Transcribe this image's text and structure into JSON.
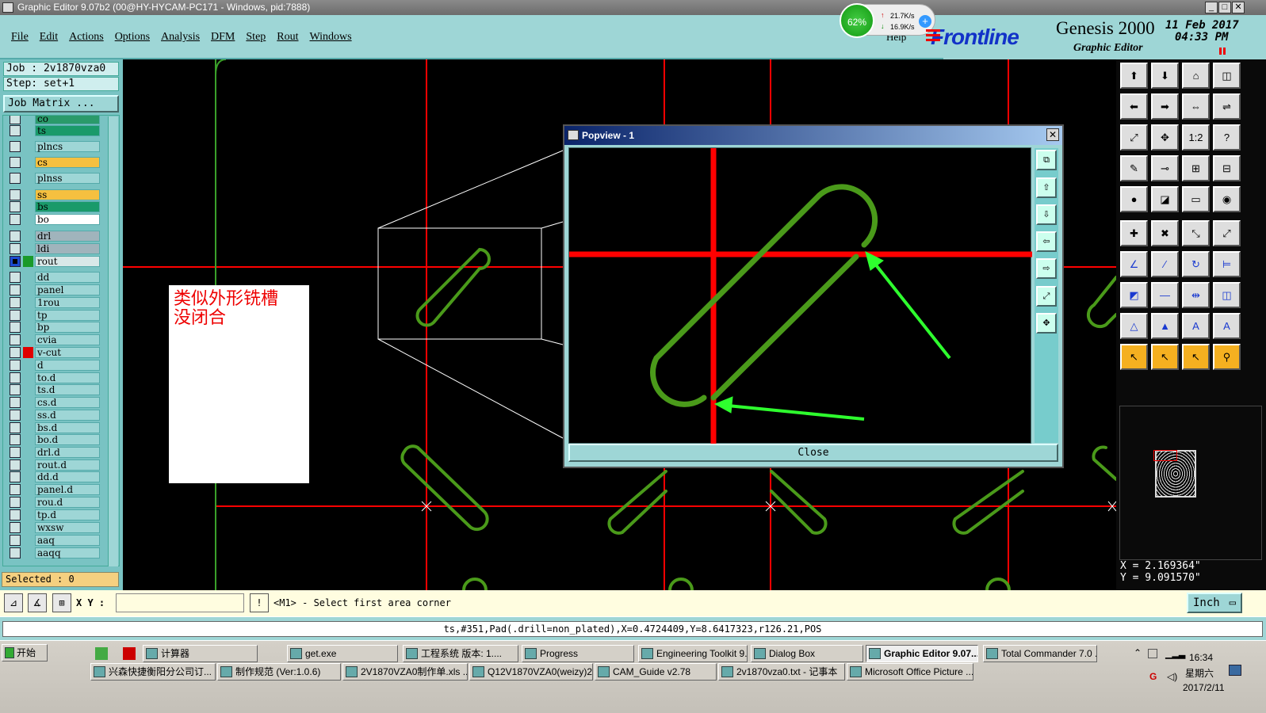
{
  "window": {
    "title": "Graphic Editor 9.07b2 (00@HY-HYCAM-PC171 - Windows, pid:7888)"
  },
  "menu": [
    "File",
    "Edit",
    "Actions",
    "Options",
    "Analysis",
    "DFM",
    "Step",
    "Rout",
    "Windows"
  ],
  "brand": {
    "logo": "Frontline",
    "product": "Genesis 2000",
    "subtitle": "Graphic Editor",
    "date": "11 Feb 2017",
    "time": "04:33 PM",
    "help": "Help"
  },
  "net": {
    "percent": "62%",
    "up": "21.7K/s",
    "down": "16.9K/s"
  },
  "left": {
    "job": "Job : 2v1870vza0",
    "step": "Step: set+1",
    "matrix": "Job Matrix ...",
    "selected": "Selected : 0",
    "layers": [
      {
        "name": "co",
        "color": "#2a9a6a",
        "checked": false
      },
      {
        "name": "ts",
        "color": "#1a9a6a",
        "checked": false
      },
      {
        "name": "plncs",
        "color": "#9ed6d6",
        "checked": false
      },
      {
        "name": "cs",
        "color": "#f5c040",
        "checked": false
      },
      {
        "name": "plnss",
        "color": "#9ed6d6",
        "checked": false
      },
      {
        "name": "ss",
        "color": "#f5c040",
        "checked": false
      },
      {
        "name": "bs",
        "color": "#1a9a6a",
        "checked": false
      },
      {
        "name": "bo",
        "color": "#ffffff",
        "checked": false
      },
      {
        "name": "drl",
        "color": "#a0b4bc",
        "checked": false
      },
      {
        "name": "ldi",
        "color": "#a0b4bc",
        "checked": false
      },
      {
        "name": "rout",
        "color": "#d8e8e8",
        "checked": true,
        "active": "#1a9a2a"
      },
      {
        "name": "dd",
        "color": "#9ed6d6",
        "checked": false
      },
      {
        "name": "panel",
        "color": "#9ed6d6",
        "checked": false
      },
      {
        "name": "1rou",
        "color": "#9ed6d6",
        "checked": false
      },
      {
        "name": "tp",
        "color": "#9ed6d6",
        "checked": false
      },
      {
        "name": "bp",
        "color": "#9ed6d6",
        "checked": false
      },
      {
        "name": "cvia",
        "color": "#9ed6d6",
        "checked": false
      },
      {
        "name": "v-cut",
        "color": "#9ed6d6",
        "checked": false,
        "active": "#e00000"
      },
      {
        "name": "d",
        "color": "#9ed6d6",
        "checked": false
      },
      {
        "name": "to.d",
        "color": "#9ed6d6",
        "checked": false
      },
      {
        "name": "ts.d",
        "color": "#9ed6d6",
        "checked": false
      },
      {
        "name": "cs.d",
        "color": "#9ed6d6",
        "checked": false
      },
      {
        "name": "ss.d",
        "color": "#9ed6d6",
        "checked": false
      },
      {
        "name": "bs.d",
        "color": "#9ed6d6",
        "checked": false
      },
      {
        "name": "bo.d",
        "color": "#9ed6d6",
        "checked": false
      },
      {
        "name": "drl.d",
        "color": "#9ed6d6",
        "checked": false
      },
      {
        "name": "rout.d",
        "color": "#9ed6d6",
        "checked": false
      },
      {
        "name": "dd.d",
        "color": "#9ed6d6",
        "checked": false
      },
      {
        "name": "panel.d",
        "color": "#9ed6d6",
        "checked": false
      },
      {
        "name": "rou.d",
        "color": "#9ed6d6",
        "checked": false
      },
      {
        "name": "tp.d",
        "color": "#9ed6d6",
        "checked": false
      },
      {
        "name": "wxsw",
        "color": "#9ed6d6",
        "checked": false
      },
      {
        "name": "aaq",
        "color": "#9ed6d6",
        "checked": false
      },
      {
        "name": "aaqq",
        "color": "#9ed6d6",
        "checked": false
      }
    ]
  },
  "popview": {
    "title": "Popview - 1",
    "close": "Close"
  },
  "note": {
    "line1": "类似外形铣槽",
    "line2": "没闭合"
  },
  "coords": {
    "x": "X = 2.169364\"",
    "y": "Y = 9.091570\""
  },
  "cmd": {
    "xy_label": "X Y :",
    "prompt": "<M1> - Select first area corner",
    "unit": "Inch"
  },
  "status": "ts,#351,Pad(.drill=non_plated),X=0.4724409,Y=8.6417323,r126.21,POS",
  "taskbar": {
    "start": "开始",
    "row1": [
      "计算器",
      "get.exe",
      "工程系统  版本: 1....",
      "Progress",
      "Engineering Toolkit 9....",
      "Dialog Box",
      "Graphic Editor 9.07...",
      "Total Commander 7.0 ..."
    ],
    "row2": [
      "兴森快捷衡阳分公司订...",
      "制作规范 (Ver:1.0.6)",
      "2V1870VZA0制作单.xls ...",
      "Q12V1870VZA0(weizy)2...",
      "CAM_Guide v2.78",
      "2v1870vza0.txt - 记事本",
      "Microsoft Office Picture ..."
    ],
    "clock": "16:34",
    "weekday": "星期六",
    "date": "2017/2/11"
  },
  "colors": {
    "panel": "#9ed6d6",
    "red_line": "#ff0000",
    "green_line": "#2eff2e",
    "rout": "#4a9a1a"
  }
}
